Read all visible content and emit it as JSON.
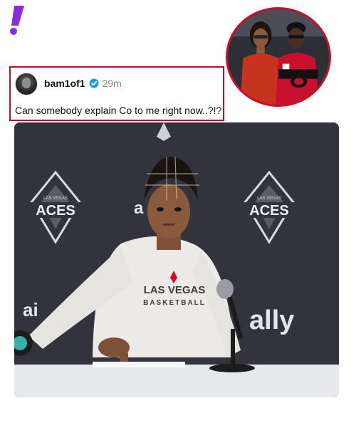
{
  "brand": {
    "logo_icon": "exclamation-logo-icon",
    "color": "#8b2be2"
  },
  "corner_photo": {
    "description_icon": "couple-courtside-photo",
    "border_color": "#c8102e"
  },
  "tweet": {
    "handle": "bam1of1",
    "verified_icon": "verified-badge-icon",
    "time": "29m",
    "text": "Can somebody explain Co to me right now..?!?",
    "border_color": "#b5122e"
  },
  "video": {
    "backdrop_logo_top": "LAS VEGAS",
    "backdrop_logo_text": "ACES",
    "shirt_line1": "LAS VEGAS",
    "shirt_line2": "BASKETBALL",
    "sponsor_partial": "ally",
    "sponsor_partial_left": "ai",
    "sponsor_partial_mid": "a"
  }
}
